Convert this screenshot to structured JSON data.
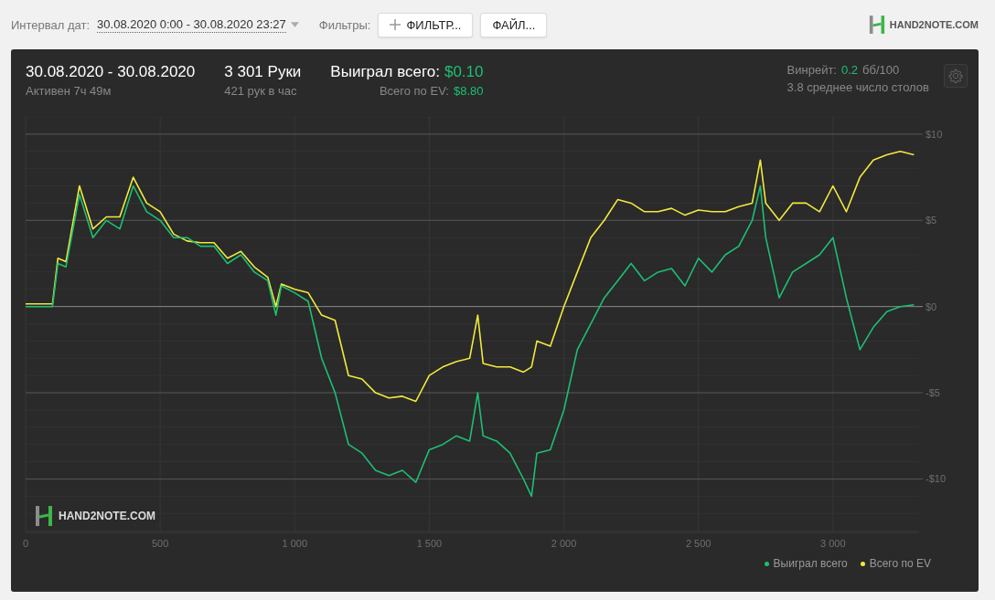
{
  "toolbar": {
    "date_label": "Интервал дат:",
    "date_range": "30.08.2020 0:00 - 30.08.2020 23:27",
    "filters_label": "Фильтры:",
    "buttons": [
      {
        "label": "ФИЛЬТР...",
        "kind": "add"
      },
      {
        "label": "ФАЙЛ...",
        "kind": "plain"
      }
    ],
    "logo": "HAND2NOTE.COM"
  },
  "summary": {
    "period": "30.08.2020 - 30.08.2020",
    "active": "Активен 7ч 49м",
    "hands": "3 301 Руки",
    "hands_per_hour": "421 рук в час",
    "won_label": "Выиграл всего:",
    "won_value": "$0.10",
    "ev_label": "Всего по EV:",
    "ev_value": "$8.80",
    "winrate_label": "Винрейт:",
    "winrate_value": "0.2",
    "winrate_unit": "бб/100",
    "tables": "3.8 среднее число столов"
  },
  "chart": {
    "watermark": "HAND2NOTE.COM",
    "chart_data": {
      "type": "line",
      "x": [
        0,
        100,
        120,
        150,
        200,
        250,
        300,
        350,
        400,
        450,
        500,
        550,
        600,
        650,
        700,
        750,
        800,
        850,
        900,
        930,
        950,
        1000,
        1050,
        1100,
        1150,
        1200,
        1250,
        1300,
        1350,
        1400,
        1450,
        1500,
        1550,
        1600,
        1650,
        1680,
        1700,
        1750,
        1800,
        1850,
        1880,
        1900,
        1950,
        2000,
        2050,
        2100,
        2150,
        2200,
        2250,
        2300,
        2350,
        2400,
        2450,
        2500,
        2550,
        2600,
        2650,
        2700,
        2730,
        2750,
        2800,
        2850,
        2900,
        2950,
        3000,
        3050,
        3100,
        3150,
        3200,
        3250,
        3301
      ],
      "series": [
        {
          "name": "Выиграл всего",
          "color": "#1dbf73",
          "values": [
            0,
            0,
            2.5,
            2.3,
            6.5,
            4,
            5,
            4.5,
            7,
            5.5,
            5,
            4,
            4,
            3.5,
            3.5,
            2.5,
            3,
            2,
            1.5,
            -0.5,
            1.2,
            0.8,
            0.3,
            -3,
            -5,
            -8,
            -8.5,
            -9.5,
            -9.8,
            -9.5,
            -10.2,
            -8.3,
            -8,
            -7.5,
            -7.8,
            -5,
            -7.5,
            -7.8,
            -8.5,
            -10,
            -11,
            -8.5,
            -8.3,
            -6,
            -2.5,
            -1,
            0.5,
            1.5,
            2.5,
            1.5,
            2,
            2.2,
            1.2,
            2.8,
            2,
            3,
            3.5,
            5,
            7,
            4,
            0.5,
            2,
            2.5,
            3,
            4,
            0.5,
            -2.5,
            -1.2,
            -0.3,
            0,
            0.1
          ]
        },
        {
          "name": "Всего по EV",
          "color": "#f2ea3c",
          "values": [
            0.15,
            0.15,
            2.8,
            2.6,
            7,
            4.5,
            5.2,
            5.2,
            7.5,
            6,
            5.5,
            4.2,
            3.8,
            3.7,
            3.7,
            2.8,
            3.2,
            2.3,
            1.7,
            0,
            1.3,
            1,
            0.8,
            -0.5,
            -0.8,
            -4,
            -4.2,
            -5,
            -5.3,
            -5.2,
            -5.5,
            -4,
            -3.5,
            -3.2,
            -3,
            -0.5,
            -3.3,
            -3.5,
            -3.5,
            -3.8,
            -3.5,
            -2,
            -2.3,
            0,
            2,
            4,
            5,
            6.2,
            6,
            5.5,
            5.5,
            5.7,
            5.3,
            5.6,
            5.5,
            5.5,
            5.8,
            6,
            8.5,
            6,
            5,
            6,
            6,
            5.5,
            7,
            5.5,
            7.5,
            8.5,
            8.8,
            9,
            8.8
          ]
        }
      ],
      "grid": true,
      "xlim": [
        0,
        3320
      ],
      "ylim": [
        -13.1,
        11
      ],
      "xticks": [
        0,
        {
          "value": 500,
          "label": "500"
        },
        {
          "value": 1000,
          "label": "1 000"
        },
        {
          "value": 1500,
          "label": "1 500"
        },
        {
          "value": 2000,
          "label": "2 000"
        },
        {
          "value": 2500,
          "label": "2 500"
        },
        {
          "value": 3000,
          "label": "3 000"
        }
      ],
      "yticks": [
        {
          "value": 10,
          "label": "$10"
        },
        {
          "value": 5,
          "label": "$5"
        },
        {
          "value": 0,
          "label": "$0"
        },
        {
          "value": -5,
          "label": "-$5"
        },
        {
          "value": -10,
          "label": "-$10"
        }
      ]
    }
  }
}
